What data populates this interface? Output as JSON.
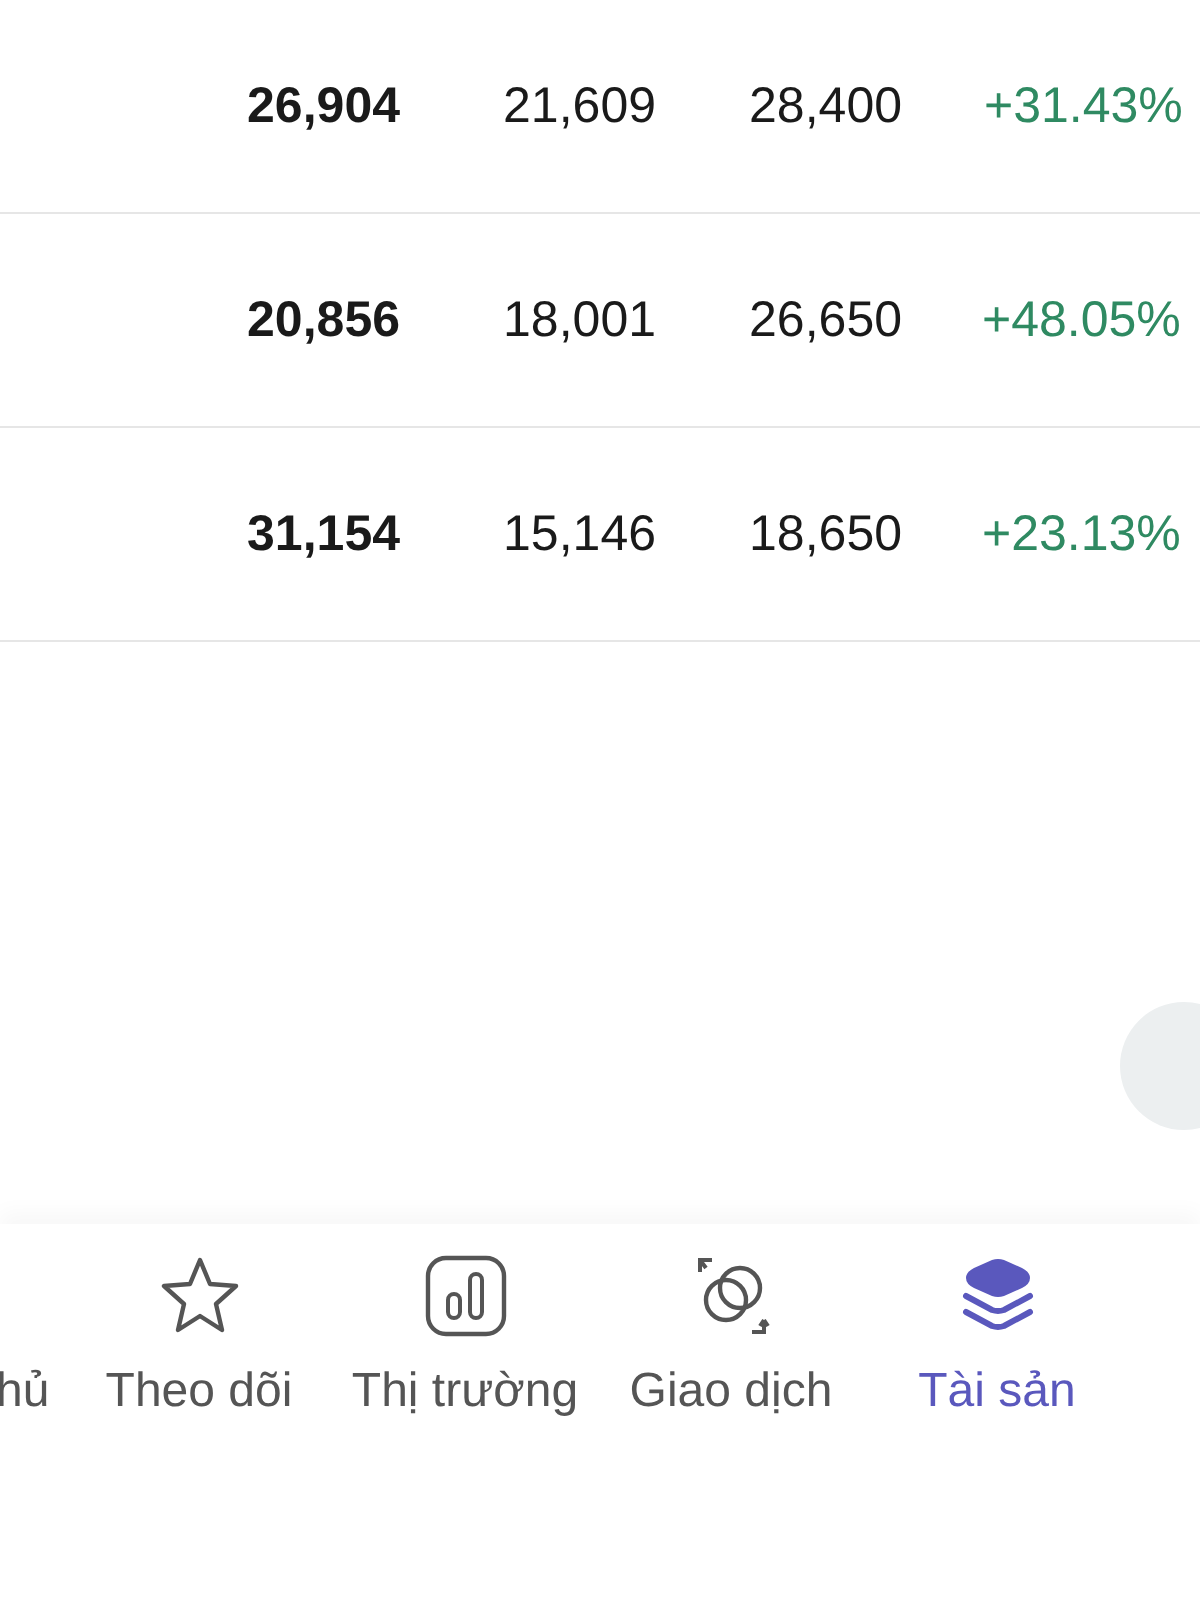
{
  "rows": [
    {
      "value": "26,904",
      "col_2": "21,609",
      "col_3": "28,400",
      "change": "+31.43%"
    },
    {
      "value": "20,856",
      "col_2": "18,001",
      "col_3": "26,650",
      "change": "+48.05%"
    },
    {
      "value": "31,154",
      "col_2": "15,146",
      "col_3": "18,650",
      "change": "+23.13%"
    }
  ],
  "nav": [
    {
      "label": "hủ",
      "kind": "cut",
      "selected": false
    },
    {
      "label": "Theo dõi",
      "kind": "star",
      "selected": false
    },
    {
      "label": "Thị trường",
      "kind": "chart",
      "selected": false
    },
    {
      "label": "Giao dịch",
      "kind": "exchange",
      "selected": false
    },
    {
      "label": "Tài sản",
      "kind": "layers",
      "selected": true
    }
  ]
}
